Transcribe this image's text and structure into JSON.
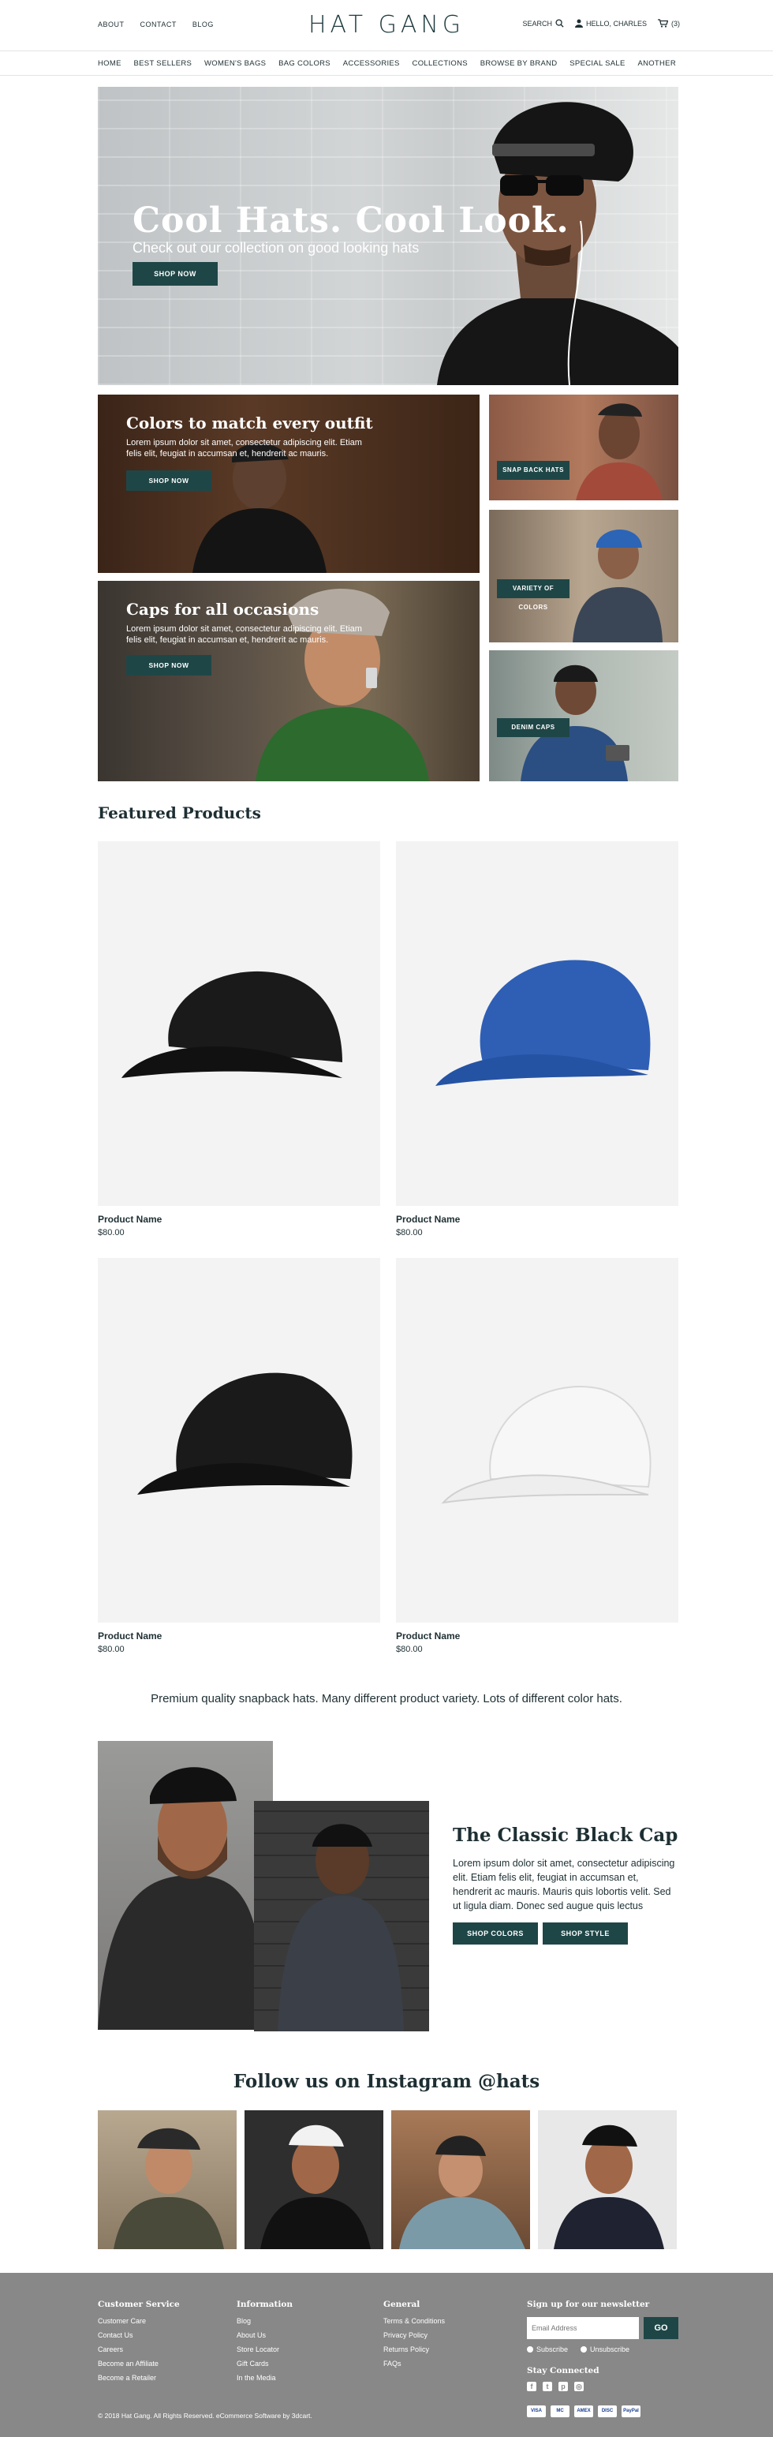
{
  "top": {
    "links": [
      "ABOUT",
      "CONTACT",
      "BLOG"
    ],
    "logo": "HAT GANG",
    "search": "SEARCH",
    "user": "HELLO, CHARLES",
    "cart": "(3)"
  },
  "nav": [
    "HOME",
    "BEST SELLERS",
    "WOMEN'S BAGS",
    "BAG COLORS",
    "ACCESSORIES",
    "COLLECTIONS",
    "BROWSE BY BRAND",
    "SPECIAL SALE",
    "ANOTHER"
  ],
  "hero": {
    "title": "Cool Hats. Cool Look.",
    "subtitle": "Check out our collection on good looking hats",
    "button": "SHOP NOW"
  },
  "tiles": {
    "colors": {
      "title": "Colors to match every outfit",
      "text": "Lorem ipsum dolor sit amet, consectetur adipiscing elit. Etiam felis elit, feugiat in accumsan et, hendrerit ac mauris.",
      "button": "SHOP NOW"
    },
    "occasions": {
      "title": "Caps for all occasions",
      "text": "Lorem ipsum dolor sit amet, consectetur adipiscing elit. Etiam felis elit, feugiat in accumsan et, hendrerit ac mauris.",
      "button": "SHOP NOW"
    },
    "snapback": "SNAP BACK HATS",
    "variety": "VARIETY OF COLORS",
    "denim": "DENIM CAPS"
  },
  "featured": {
    "title": "Featured Products",
    "products": [
      {
        "name": "Product Name",
        "price": "$80.00",
        "color": "#1a1a1a"
      },
      {
        "name": "Product Name",
        "price": "$80.00",
        "color": "#2f5fb5"
      },
      {
        "name": "Product Name",
        "price": "$80.00",
        "color": "#1a1a1a"
      },
      {
        "name": "Product Name",
        "price": "$80.00",
        "color": "#f4f4f4"
      }
    ]
  },
  "tagline": "Premium quality snapback hats. Many different product variety. Lots of different color hats.",
  "classic": {
    "title": "The Classic Black Cap",
    "text": "Lorem ipsum dolor sit amet, consectetur adipiscing elit. Etiam felis elit, feugiat in accumsan et, hendrerit ac mauris. Mauris quis lobortis velit. Sed ut ligula diam. Donec sed augue quis lectus",
    "button1": "SHOP COLORS",
    "button2": "SHOP STYLE"
  },
  "instagram": {
    "title": "Follow us on Instagram @hats"
  },
  "footer": {
    "customer": {
      "title": "Customer Service",
      "items": [
        "Customer Care",
        "Contact Us",
        "Careers",
        "Become an Affiliate",
        "Become a Retailer"
      ]
    },
    "info": {
      "title": "Information",
      "items": [
        "Blog",
        "About Us",
        "Store Locator",
        "Gift Cards",
        "In the Media"
      ]
    },
    "general": {
      "title": "General",
      "items": [
        "Terms & Conditions",
        "Privacy Policy",
        "Returns Policy",
        "FAQs"
      ]
    },
    "newsletter": {
      "title": "Sign up for our newsletter",
      "placeholder": "Email Address",
      "go": "GO",
      "subscribe": "Subscribe",
      "unsubscribe": "Unsubscribe"
    },
    "stay": "Stay Connected",
    "cards": [
      "VISA",
      "MC",
      "AMEX",
      "DISC",
      "PayPal"
    ],
    "copyright": "© 2018 Hat Gang. All Rights Reserved. eCommerce Software by 3dcart."
  },
  "colors": {
    "accent": "#1f4647",
    "footer": "#888888"
  }
}
